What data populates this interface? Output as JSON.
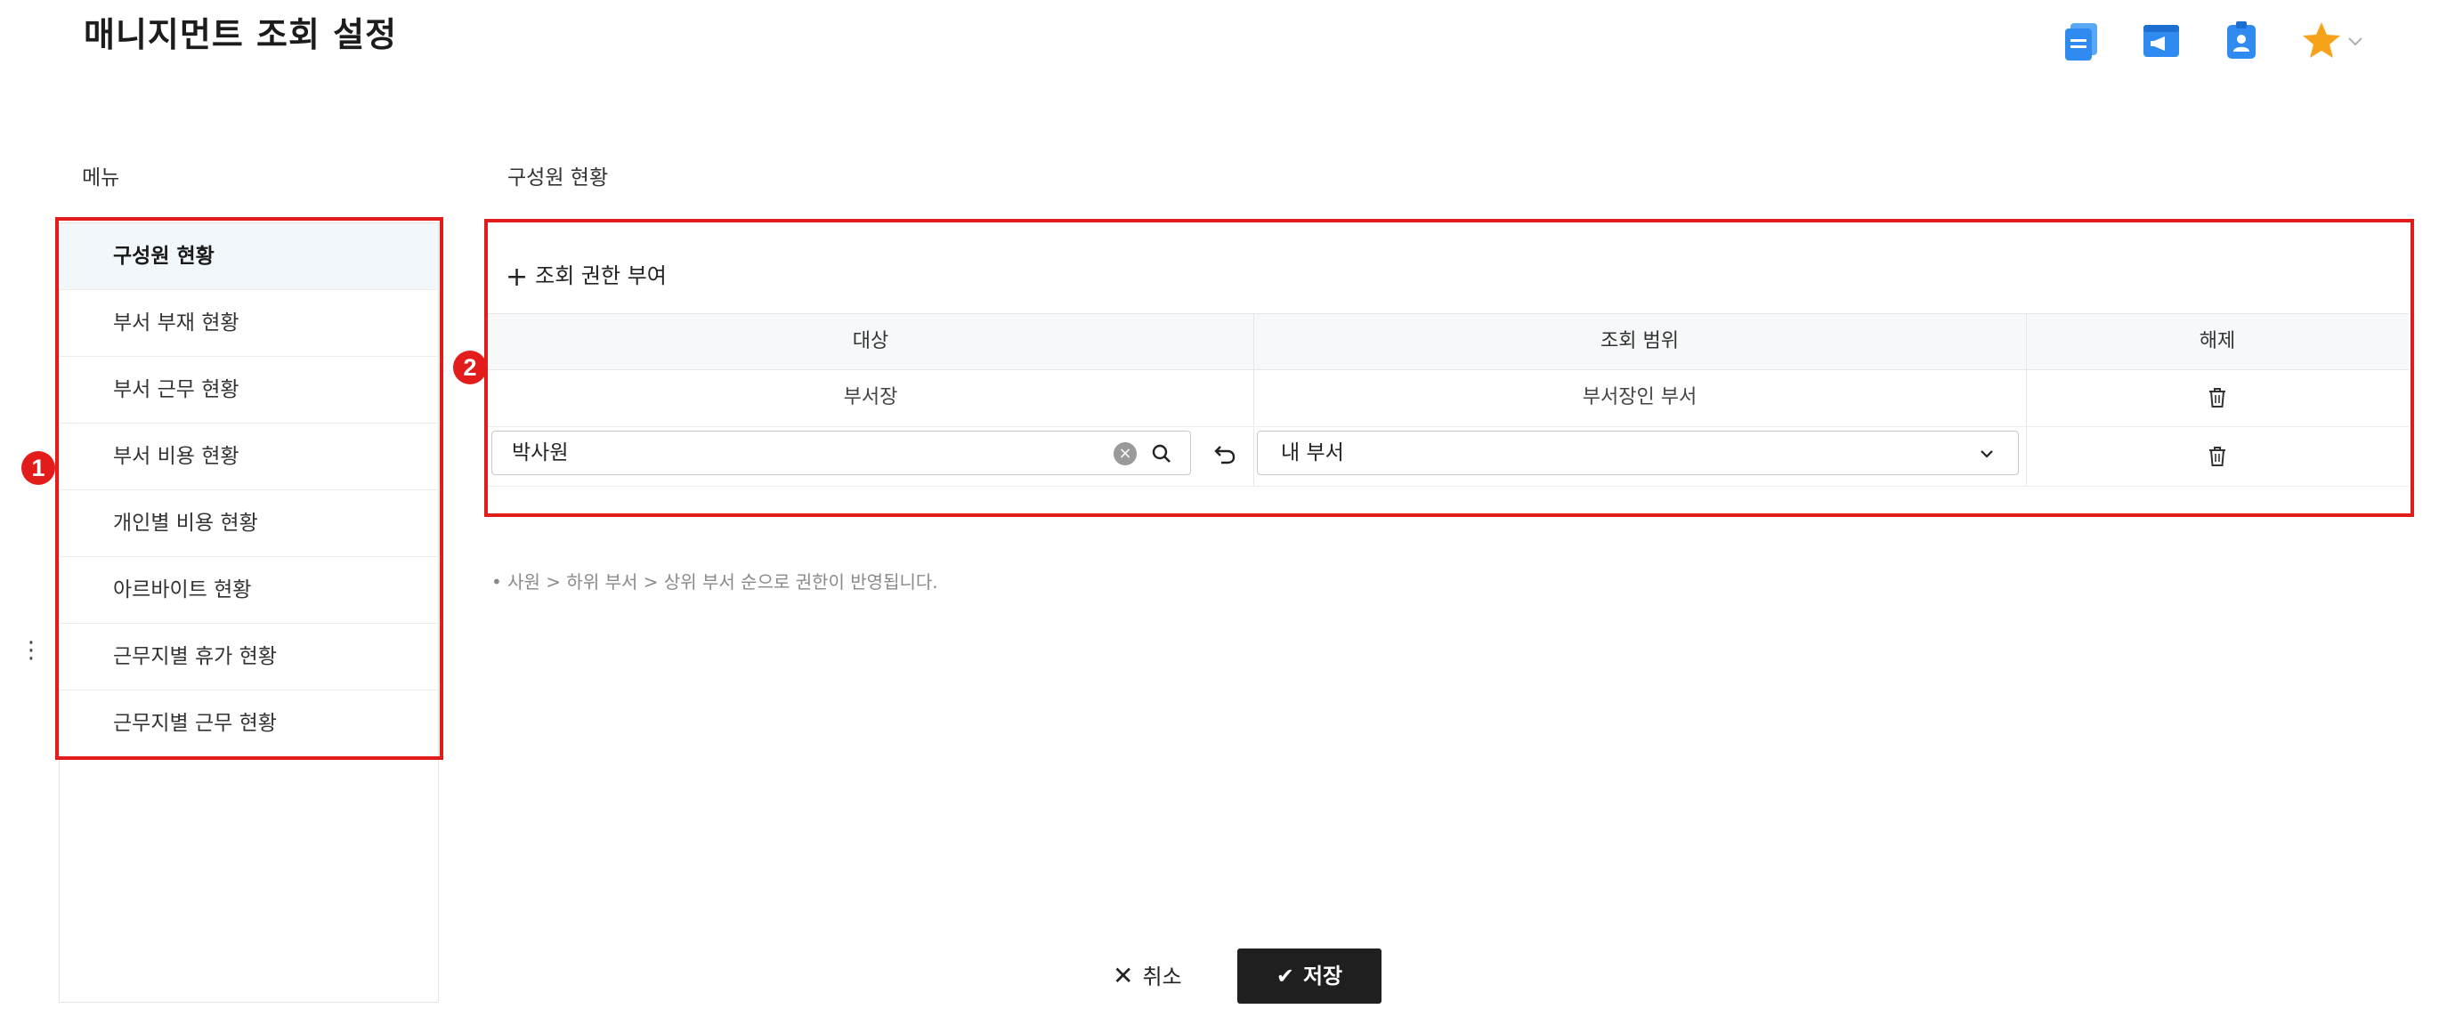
{
  "header": {
    "title": "매니지먼트 조회 설정",
    "icons": [
      "document-icon",
      "announcement-icon",
      "contact-badge-icon",
      "star-icon"
    ]
  },
  "colors": {
    "accent_blue": "#2f8bf0",
    "highlight_red": "#e21b1b",
    "star": "#f7a21b",
    "active_menu_bg": "#f2f7fc",
    "save_bg": "#1f1f1f"
  },
  "sidebar": {
    "label": "메뉴",
    "items": [
      {
        "label": "구성원 현황"
      },
      {
        "label": "부서 부재 현황"
      },
      {
        "label": "부서 근무 현황"
      },
      {
        "label": "부서 비용 현황"
      },
      {
        "label": "개인별 비용 현황"
      },
      {
        "label": "아르바이트 현황"
      },
      {
        "label": "근무지별 휴가 현황"
      },
      {
        "label": "근무지별 근무 현황"
      }
    ]
  },
  "markers": {
    "one": "1",
    "two": "2"
  },
  "content": {
    "label": "구성원 현황",
    "add_label": "조회 권한 부여",
    "columns": [
      "대상",
      "조회 범위",
      "해제"
    ],
    "rows": [
      {
        "target": "부서장",
        "scope": "부서장인 부서"
      }
    ],
    "edit_row": {
      "target_value": "박사원",
      "scope_value": "내 부서"
    },
    "note": "• 사원 > 하위 부서 > 상위 부서 순으로 권한이 반영됩니다."
  },
  "footer": {
    "cancel_label": "취소",
    "save_label": "저장"
  }
}
